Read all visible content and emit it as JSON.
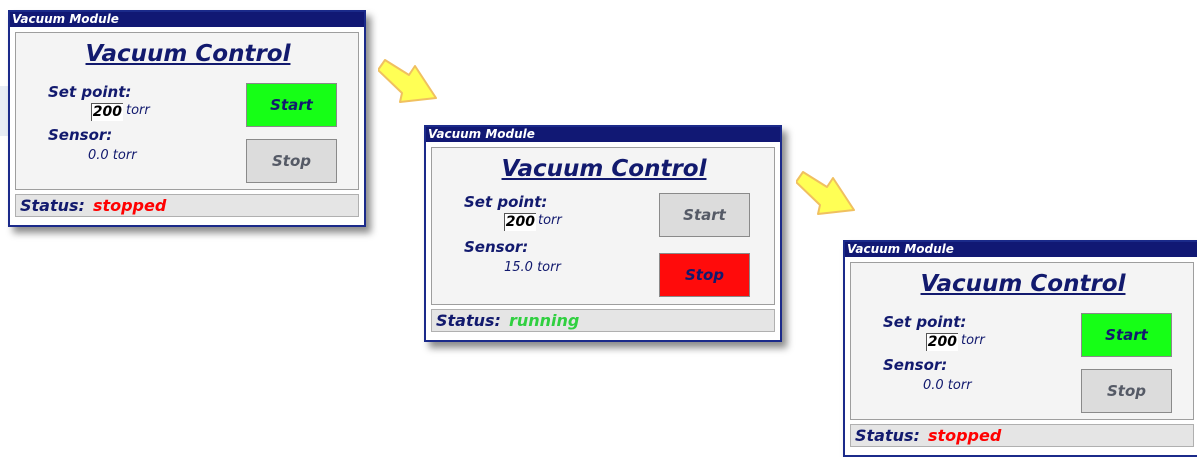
{
  "colors": {
    "title_bar": "#111874",
    "text_navy": "#121a6e",
    "start_active": "#16ff16",
    "stop_active": "#ff0b0b",
    "button_inactive": "#dcdcdc",
    "status_stopped": "#ff0000",
    "status_running": "#30d040",
    "arrow_fill": "#ffff55",
    "arrow_stroke": "#f0c060"
  },
  "panels": [
    {
      "title": "Vacuum Module",
      "heading": "Vacuum Control",
      "setpoint_label": "Set point:",
      "setpoint_value": "200",
      "setpoint_unit": "torr",
      "sensor_label": "Sensor:",
      "sensor_value": "0.0  torr",
      "start_label": "Start",
      "stop_label": "Stop",
      "active_button": "start",
      "status_label": "Status:",
      "status_value": "stopped",
      "status_color": "#ff0000"
    },
    {
      "title": "Vacuum Module",
      "heading": "Vacuum Control",
      "setpoint_label": "Set point:",
      "setpoint_value": "200",
      "setpoint_unit": "torr",
      "sensor_label": "Sensor:",
      "sensor_value": "15.0 torr",
      "start_label": "Start",
      "stop_label": "Stop",
      "active_button": "stop",
      "status_label": "Status:",
      "status_value": "running",
      "status_color": "#30d040"
    },
    {
      "title": "Vacuum Module",
      "heading": "Vacuum Control",
      "setpoint_label": "Set point:",
      "setpoint_value": "200",
      "setpoint_unit": "torr",
      "sensor_label": "Sensor:",
      "sensor_value": "0.0  torr",
      "start_label": "Start",
      "stop_label": "Stop",
      "active_button": "start",
      "status_label": "Status:",
      "status_value": "stopped",
      "status_color": "#ff0000"
    }
  ]
}
